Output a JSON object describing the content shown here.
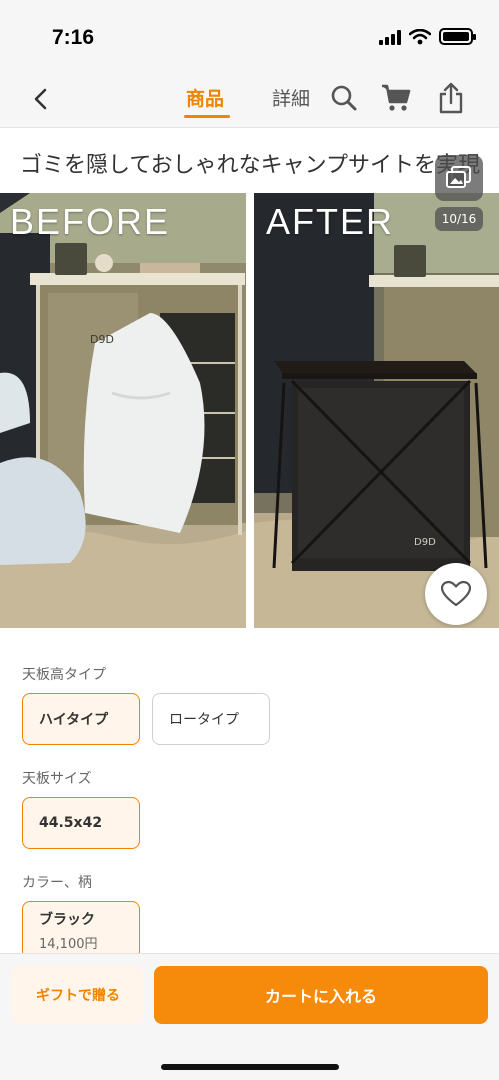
{
  "status": {
    "time": "7:16"
  },
  "nav": {
    "tab_product": "商品",
    "tab_detail": "詳細",
    "accent_color": "#f08300"
  },
  "product": {
    "title": "ゴミを隠しておしゃれなキャンプサイトを実現"
  },
  "gallery": {
    "before_label": "BEFORE",
    "after_label": "AFTER",
    "counter": "10/16",
    "current_index": 10,
    "total": 16
  },
  "options": {
    "height_type": {
      "label": "天板高タイプ",
      "choices": [
        "ハイタイプ",
        "ロータイプ"
      ],
      "selected": "ハイタイプ"
    },
    "size": {
      "label": "天板サイズ",
      "choices": [
        "44.5x42"
      ],
      "selected": "44.5x42"
    },
    "color": {
      "label": "カラー、柄",
      "choices": [
        {
          "name": "ブラック",
          "price": "14,100円"
        }
      ],
      "selected": "ブラック"
    }
  },
  "actions": {
    "gift": "ギフトで贈る",
    "cart": "カートに入れる"
  }
}
